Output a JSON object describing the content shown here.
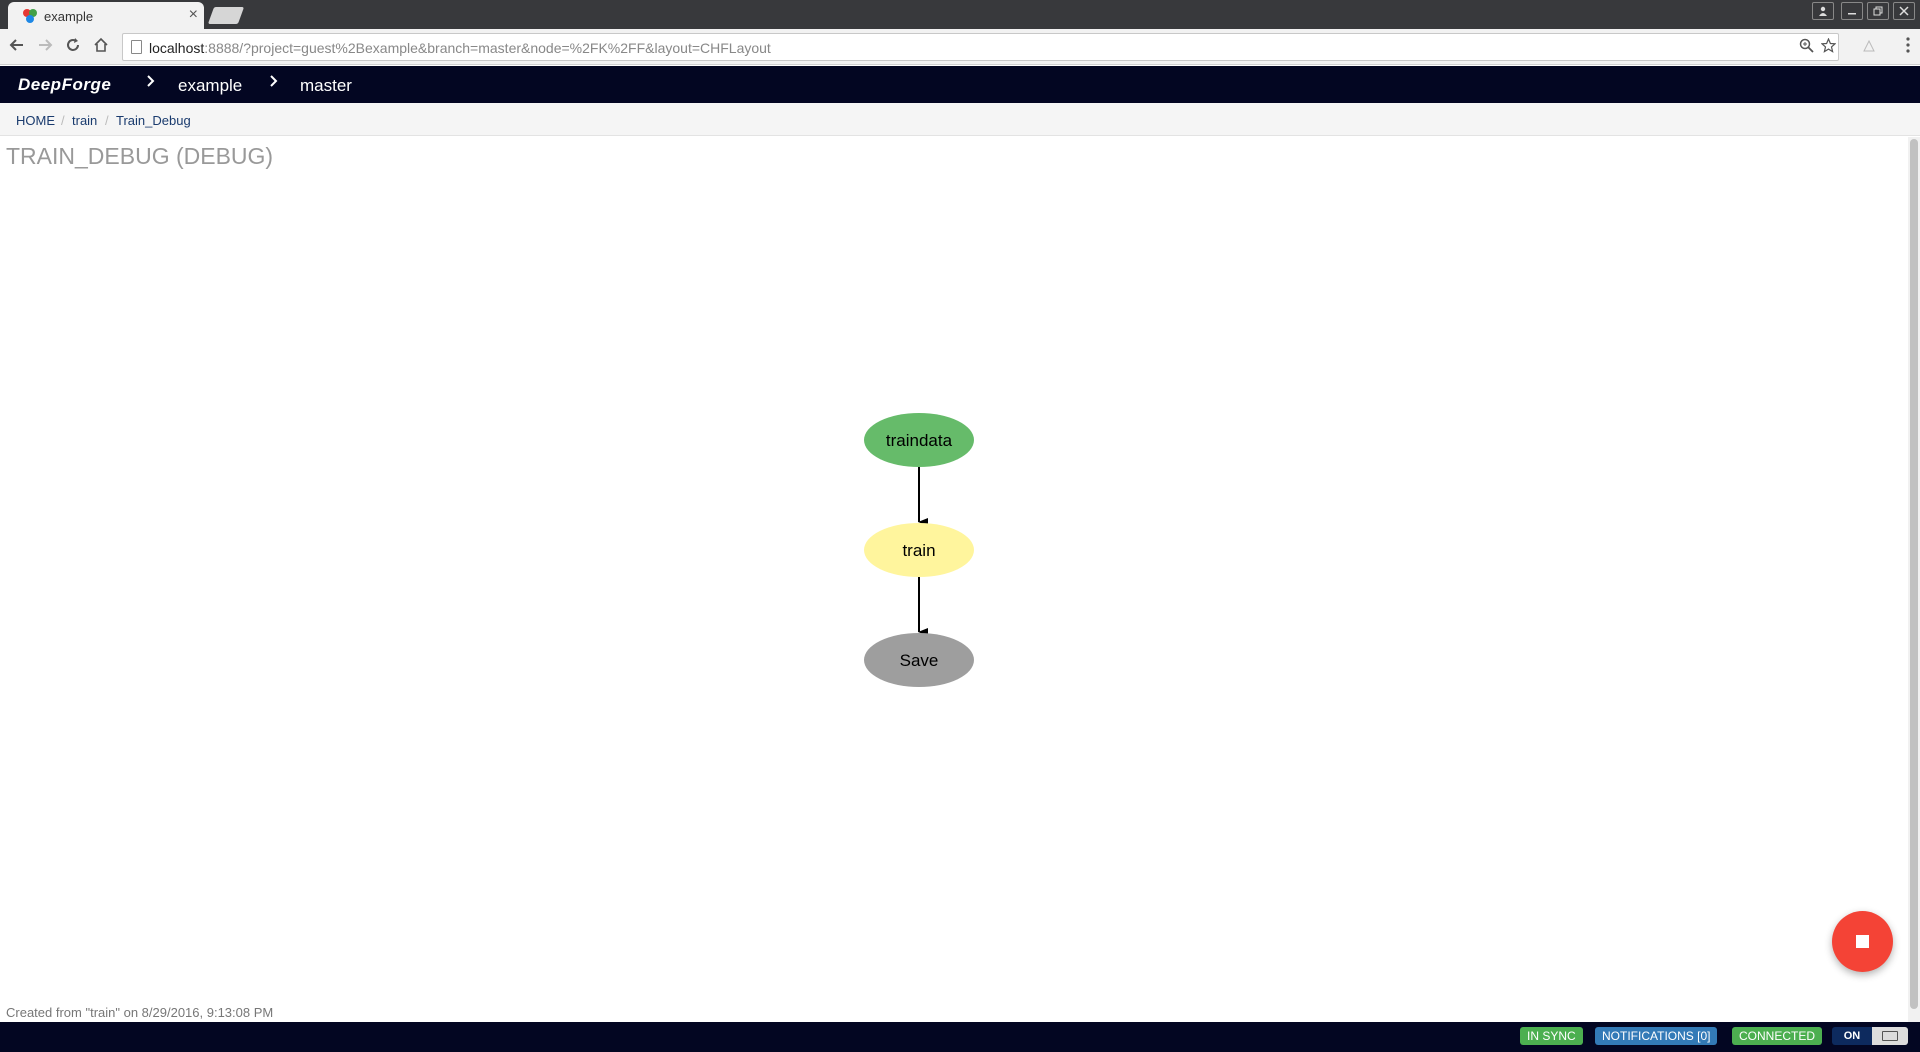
{
  "browser": {
    "tab_title": "example",
    "tab_close": "×",
    "url_host": "localhost",
    "url_rest": ":8888/?project=guest%2Bexample&branch=master&node=%2FK%2FF&layout=CHFLayout"
  },
  "navbar": {
    "brand": "DeepForge",
    "project": "example",
    "branch": "master"
  },
  "breadcrumb": {
    "items": [
      "HOME",
      "train",
      "Train_Debug"
    ]
  },
  "main": {
    "title": "TRAIN_DEBUG (DEBUG)",
    "created": "Created from \"train\" on 8/29/2016, 9:13:08 PM"
  },
  "graph": {
    "nodes": [
      {
        "label": "traindata",
        "color": "#66bb6a"
      },
      {
        "label": "train",
        "color": "#fff59d"
      },
      {
        "label": "Save",
        "color": "#9e9e9e"
      }
    ]
  },
  "footer": {
    "in_sync": "IN SYNC",
    "notifications": "NOTIFICATIONS [0]",
    "connected": "CONNECTED",
    "toggle": "ON"
  },
  "colors": {
    "navbar_bg": "#030622",
    "fab": "#f44336",
    "status_green": "#4caf50",
    "status_blue": "#337ab7"
  }
}
